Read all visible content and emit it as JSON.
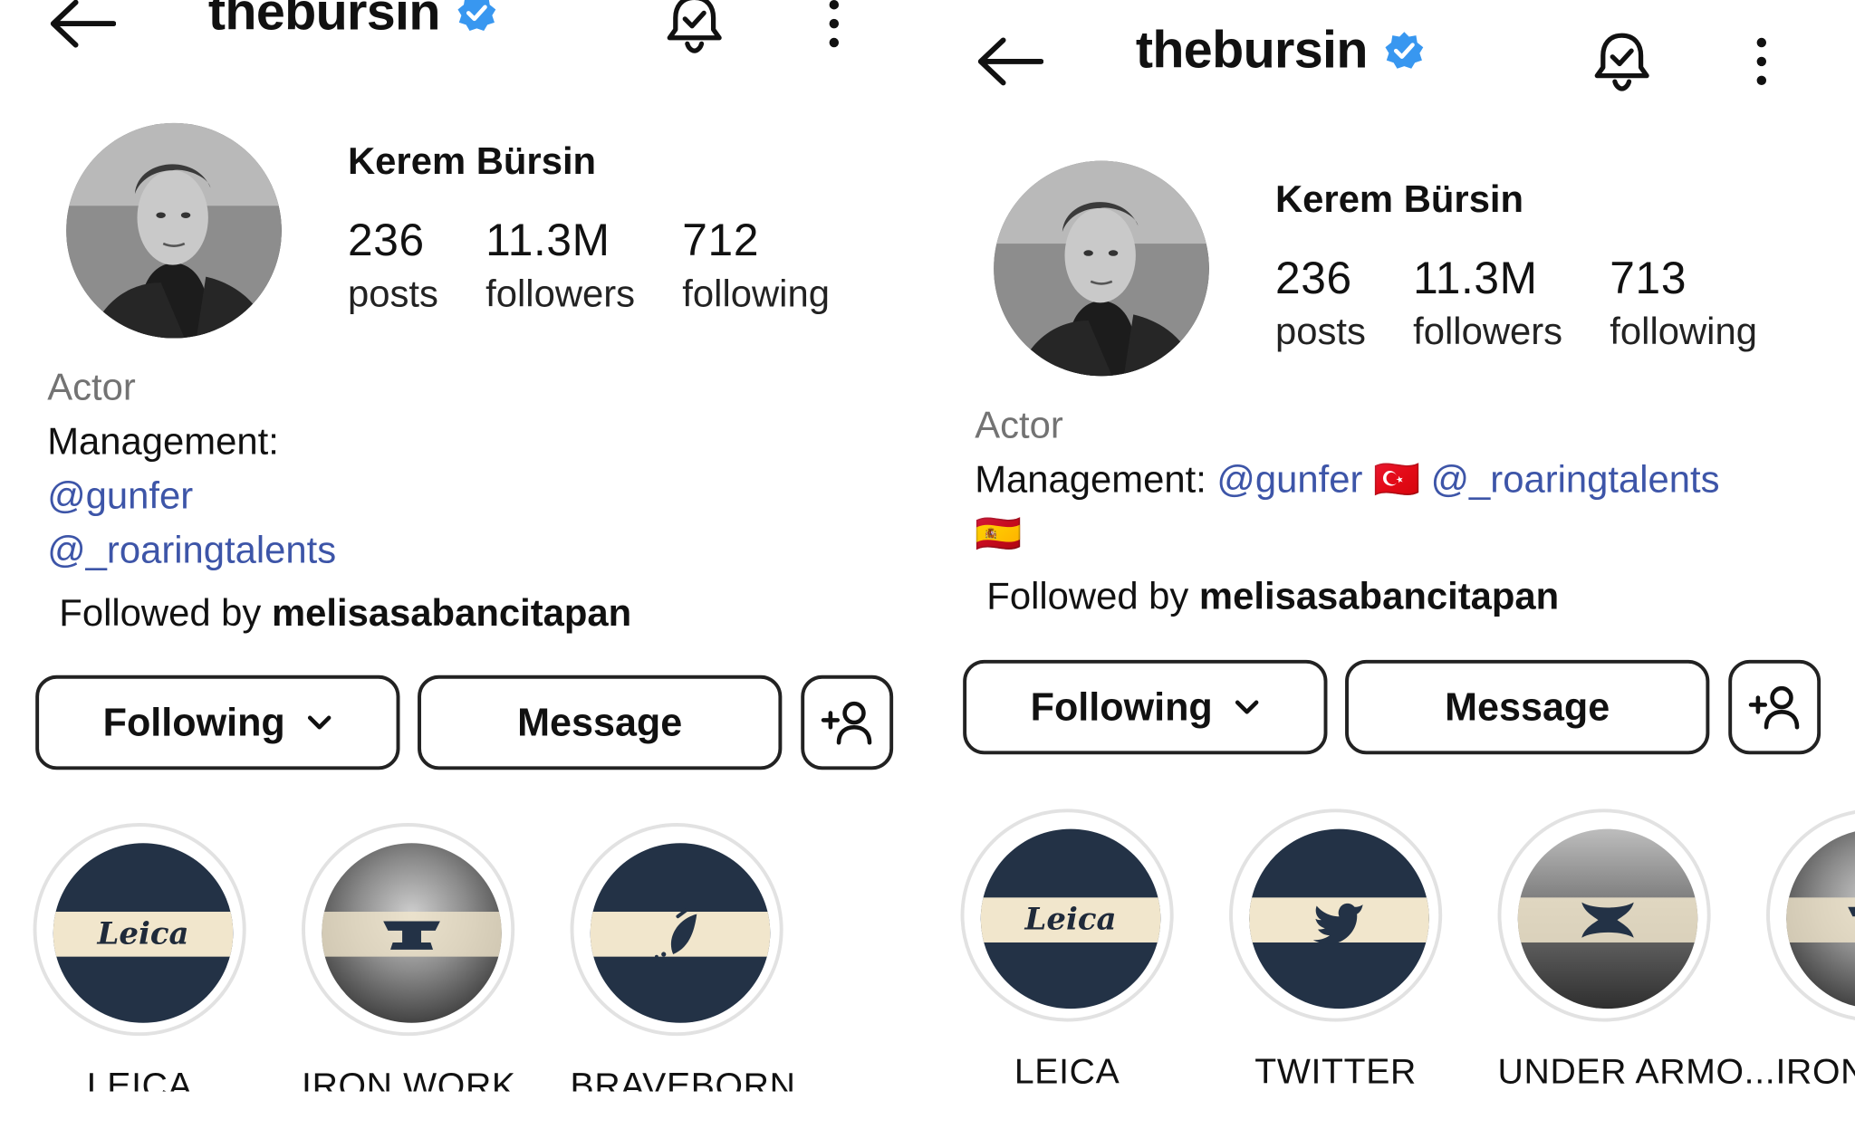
{
  "panels": [
    {
      "username": "thebursin",
      "full_name": "Kerem Bürsin",
      "stats": [
        {
          "count": "236",
          "label": "posts"
        },
        {
          "count": "11.3M",
          "label": "followers"
        },
        {
          "count": "712",
          "label": "following"
        }
      ],
      "bio": {
        "category": "Actor",
        "management_label": "Management:",
        "link_1": "@gunfer",
        "link_2": "@_roaringtalents"
      },
      "followed_by_prefix": "Followed by",
      "followed_by_user": "melisasabancitapan",
      "buttons": {
        "following": "Following",
        "message": "Message"
      },
      "highlights": [
        {
          "label": "LEICA",
          "icon": "leica-logo"
        },
        {
          "label": "IRON WORK",
          "icon": "anvil-icon"
        },
        {
          "label": "BRAVEBORN",
          "icon": "leaf-icon"
        }
      ]
    },
    {
      "username": "thebursin",
      "full_name": "Kerem Bürsin",
      "stats": [
        {
          "count": "236",
          "label": "posts"
        },
        {
          "count": "11.3M",
          "label": "followers"
        },
        {
          "count": "713",
          "label": "following"
        }
      ],
      "bio": {
        "category": "Actor",
        "management_label": "Management:",
        "link_1": "@gunfer",
        "flag_1": "🇹🇷",
        "link_2": "@_roaringtalents",
        "flag_2": "🇪🇸"
      },
      "followed_by_prefix": "Followed by",
      "followed_by_user": "melisasabancitapan",
      "buttons": {
        "following": "Following",
        "message": "Message"
      },
      "highlights": [
        {
          "label": "LEICA",
          "icon": "leica-logo"
        },
        {
          "label": "TWITTER",
          "icon": "twitter-bird-icon"
        },
        {
          "label": "UNDER ARMO...",
          "icon": "under-armour-logo"
        },
        {
          "label": "IRON",
          "icon": "anvil-icon"
        }
      ]
    }
  ],
  "colors": {
    "verified": "#3897f0",
    "link": "#3d55a8",
    "category": "#737373",
    "highlight_navy": "#233246",
    "highlight_band": "#f1e6cc"
  },
  "leica_logo_text": "Leica"
}
